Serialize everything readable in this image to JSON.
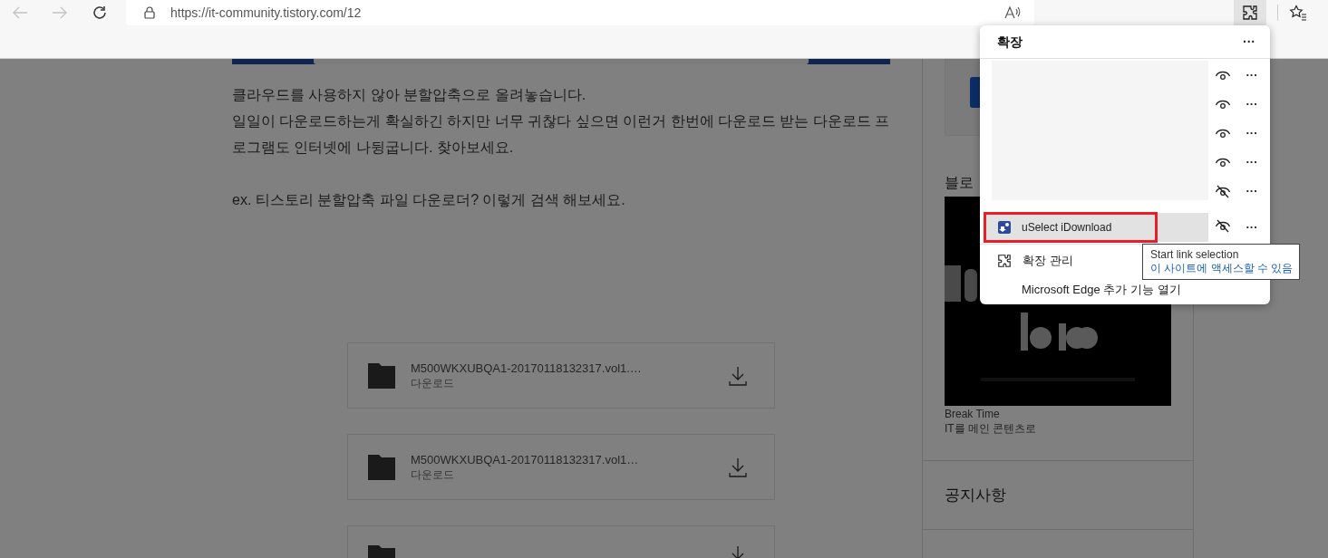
{
  "browser": {
    "url": "https://it-community.tistory.com/12"
  },
  "article": {
    "paragraphs": [
      "클라우드를 사용하지 않아 분할압축으로 올려놓습니다.",
      "일일이 다운로드하는게 확실하긴 하지만 너무 귀찮다 싶으면 이런거 한번에 다운로드 받는 다운로드 프로그램도 인터넷에 나뒹굽니다. 찾아보세요."
    ],
    "example": "ex. 티스토리 분할압축 파일 다운로더? 이렇게 검색 해보세요.",
    "files": [
      {
        "name": "M500WKXUBQA1-20170118132317.vol1.…",
        "action": "다운로드"
      },
      {
        "name": "M500WKXUBQA1-20170118132317.vol1…",
        "action": "다운로드"
      },
      {
        "kind": "cut"
      }
    ]
  },
  "sidebar": {
    "blog_heading": "블로",
    "profile": {
      "kind": "picture",
      "name": "Break Time",
      "description": "IT를 메인 콘텐츠로"
    },
    "notice_heading": "공지사항"
  },
  "extensions_popup": {
    "title": "확장",
    "more": "···",
    "rows": [
      {
        "pinned": true
      },
      {
        "pinned": true
      },
      {
        "pinned": true
      },
      {
        "pinned": true
      },
      {
        "pinned": false
      },
      {
        "name": "uSelect iDownload",
        "pinned": false,
        "hovered": true,
        "annotated": true
      }
    ],
    "row_more": "···",
    "footer": [
      {
        "kind": "manage",
        "label": "확장 관리"
      },
      {
        "kind": "store",
        "label": "Microsoft Edge 추가 기능 열기"
      }
    ]
  },
  "tooltip": {
    "title": "Start link selection",
    "access": "이 사이트에 액세스할 수 있음"
  }
}
